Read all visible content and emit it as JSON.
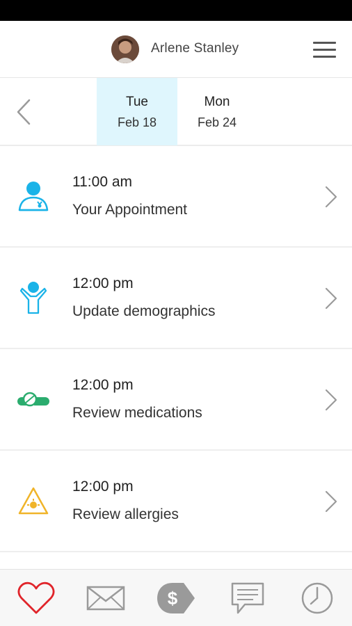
{
  "header": {
    "user_name": "Arlene Stanley",
    "avatar_icon": "user-avatar",
    "menu_icon": "hamburger-menu-icon"
  },
  "dates": {
    "back_icon": "chevron-left-icon",
    "tabs": [
      {
        "dow": "Tue",
        "date": "Feb 18",
        "active": true
      },
      {
        "dow": "Mon",
        "date": "Feb 24",
        "active": false
      }
    ],
    "active_color": "#dff6fd"
  },
  "tasks": [
    {
      "time": "11:00 am",
      "title": "Your Appointment",
      "icon": "doctor-icon",
      "color": "#1ab3e8"
    },
    {
      "time": "12:00 pm",
      "title": "Update demographics",
      "icon": "person-arms-up-icon",
      "color": "#1ab3e8"
    },
    {
      "time": "12:00 pm",
      "title": "Review medications",
      "icon": "pills-icon",
      "color": "#2bac6e"
    },
    {
      "time": "12:00 pm",
      "title": "Review allergies",
      "icon": "allergy-warning-icon",
      "color": "#f0b429"
    }
  ],
  "bottom_nav": [
    {
      "icon": "heart-icon",
      "color": "#e0242a",
      "active": true
    },
    {
      "icon": "mail-icon",
      "color": "#9a9a9a",
      "active": false
    },
    {
      "icon": "billing-tag-icon",
      "color": "#9a9a9a",
      "active": false
    },
    {
      "icon": "chat-icon",
      "color": "#9a9a9a",
      "active": false
    },
    {
      "icon": "clock-icon",
      "color": "#9a9a9a",
      "active": false
    }
  ]
}
